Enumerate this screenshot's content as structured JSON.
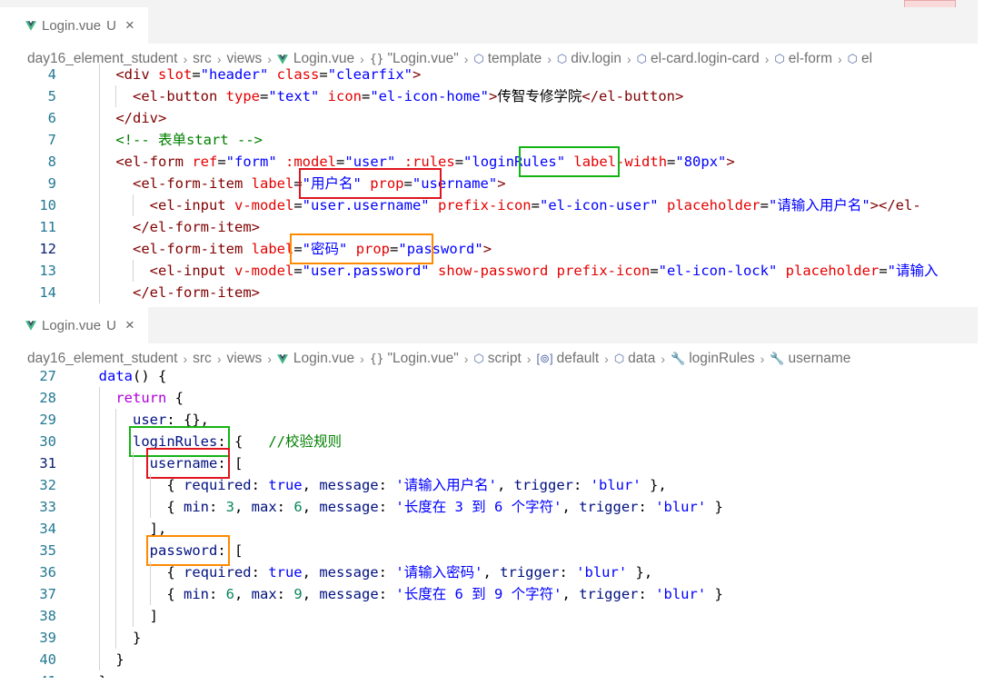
{
  "editor1": {
    "tab": {
      "file": "Login.vue",
      "status": "U",
      "close": "×"
    },
    "breadcrumb": [
      "day16_element_student",
      "src",
      "views",
      "Login.vue",
      "\"Login.vue\"",
      "template",
      "div.login",
      "el-card.login-card",
      "el-form",
      "el"
    ],
    "lines": [
      {
        "n": "4",
        "segs": [
          [
            "",
            "    "
          ],
          [
            "tag",
            "<div "
          ],
          [
            "attr",
            "slot"
          ],
          [
            "",
            "="
          ],
          [
            "str",
            "\"header\""
          ],
          [
            "",
            " "
          ],
          [
            "attr",
            "class"
          ],
          [
            "",
            "="
          ],
          [
            "str",
            "\"clearfix\""
          ],
          [
            "tag",
            ">"
          ]
        ]
      },
      {
        "n": "5",
        "segs": [
          [
            "",
            "      "
          ],
          [
            "tag",
            "<el-button "
          ],
          [
            "attr",
            "type"
          ],
          [
            "",
            "="
          ],
          [
            "str",
            "\"text\""
          ],
          [
            "",
            " "
          ],
          [
            "attr",
            "icon"
          ],
          [
            "",
            "="
          ],
          [
            "str",
            "\"el-icon-home\""
          ],
          [
            "tag",
            ">"
          ],
          [
            "",
            "传智专修学院"
          ],
          [
            "tag",
            "</el-button>"
          ]
        ]
      },
      {
        "n": "6",
        "segs": [
          [
            "",
            "    "
          ],
          [
            "tag",
            "</div>"
          ]
        ]
      },
      {
        "n": "7",
        "segs": [
          [
            "",
            "    "
          ],
          [
            "cmt",
            "<!-- 表单start -->"
          ]
        ]
      },
      {
        "n": "8",
        "segs": [
          [
            "",
            "    "
          ],
          [
            "tag",
            "<el-form "
          ],
          [
            "attr",
            "ref"
          ],
          [
            "",
            "="
          ],
          [
            "str",
            "\"form\""
          ],
          [
            "",
            " "
          ],
          [
            "attr",
            ":model"
          ],
          [
            "",
            "="
          ],
          [
            "str",
            "\"user\""
          ],
          [
            "",
            " "
          ],
          [
            "attr",
            ":rules"
          ],
          [
            "",
            "="
          ],
          [
            "str",
            "\"loginRules\""
          ],
          [
            "",
            " "
          ],
          [
            "attr",
            "label-width"
          ],
          [
            "",
            "="
          ],
          [
            "str",
            "\"80px\""
          ],
          [
            "tag",
            ">"
          ]
        ]
      },
      {
        "n": "9",
        "segs": [
          [
            "",
            "      "
          ],
          [
            "tag",
            "<el-form-item "
          ],
          [
            "attr",
            "label"
          ],
          [
            "",
            "="
          ],
          [
            "str",
            "\"用户名\""
          ],
          [
            "",
            " "
          ],
          [
            "attr",
            "prop"
          ],
          [
            "",
            "="
          ],
          [
            "str",
            "\"username\""
          ],
          [
            "tag",
            ">"
          ]
        ]
      },
      {
        "n": "10",
        "segs": [
          [
            "",
            "        "
          ],
          [
            "tag",
            "<el-input "
          ],
          [
            "attr",
            "v-model"
          ],
          [
            "",
            "="
          ],
          [
            "str",
            "\"user.username\""
          ],
          [
            "",
            " "
          ],
          [
            "attr",
            "prefix-icon"
          ],
          [
            "",
            "="
          ],
          [
            "str",
            "\"el-icon-user\""
          ],
          [
            "",
            " "
          ],
          [
            "attr",
            "placeholder"
          ],
          [
            "",
            "="
          ],
          [
            "str",
            "\"请输入用户名\""
          ],
          [
            "tag",
            "></el-"
          ]
        ]
      },
      {
        "n": "11",
        "segs": [
          [
            "",
            "      "
          ],
          [
            "tag",
            "</el-form-item>"
          ]
        ]
      },
      {
        "n": "12",
        "segs": [
          [
            "",
            "      "
          ],
          [
            "tag",
            "<el-form-item "
          ],
          [
            "attr",
            "label"
          ],
          [
            "",
            "="
          ],
          [
            "str",
            "\"密码\""
          ],
          [
            "",
            " "
          ],
          [
            "attr",
            "prop"
          ],
          [
            "",
            "="
          ],
          [
            "str",
            "\"password\""
          ],
          [
            "tag",
            ">"
          ]
        ]
      },
      {
        "n": "13",
        "segs": [
          [
            "",
            "        "
          ],
          [
            "tag",
            "<el-input "
          ],
          [
            "attr",
            "v-model"
          ],
          [
            "",
            "="
          ],
          [
            "str",
            "\"user.password\""
          ],
          [
            "",
            " "
          ],
          [
            "attr",
            "show-password"
          ],
          [
            "",
            " "
          ],
          [
            "attr",
            "prefix-icon"
          ],
          [
            "",
            "="
          ],
          [
            "str",
            "\"el-icon-lock\""
          ],
          [
            "",
            " "
          ],
          [
            "attr",
            "placeholder"
          ],
          [
            "",
            "="
          ],
          [
            "str",
            "\"请输入"
          ]
        ]
      },
      {
        "n": "14",
        "segs": [
          [
            "",
            "      "
          ],
          [
            "tag",
            "</el-form-item>"
          ]
        ]
      }
    ]
  },
  "editor2": {
    "tab": {
      "file": "Login.vue",
      "status": "U",
      "close": "×"
    },
    "breadcrumb": [
      "day16_element_student",
      "src",
      "views",
      "Login.vue",
      "\"Login.vue\"",
      "script",
      "default",
      "data",
      "loginRules",
      "username"
    ],
    "lines": [
      {
        "n": "27",
        "segs": [
          [
            "",
            "  "
          ],
          [
            "kw",
            "data"
          ],
          [
            "",
            "() {"
          ]
        ]
      },
      {
        "n": "28",
        "segs": [
          [
            "",
            "    "
          ],
          [
            "ctl",
            "return"
          ],
          [
            "",
            " {"
          ]
        ]
      },
      {
        "n": "29",
        "segs": [
          [
            "",
            "      "
          ],
          [
            "prop",
            "user"
          ],
          [
            "",
            ": {},"
          ]
        ]
      },
      {
        "n": "30",
        "segs": [
          [
            "",
            "      "
          ],
          [
            "prop",
            "loginRules"
          ],
          [
            "",
            ": {   "
          ],
          [
            "cmt",
            "//校验规则"
          ]
        ]
      },
      {
        "n": "31",
        "segs": [
          [
            "",
            "        "
          ],
          [
            "prop",
            "username"
          ],
          [
            "",
            ": ["
          ]
        ]
      },
      {
        "n": "32",
        "segs": [
          [
            "",
            "          { "
          ],
          [
            "prop",
            "required"
          ],
          [
            "",
            ": "
          ],
          [
            "kw",
            "true"
          ],
          [
            "",
            ", "
          ],
          [
            "prop",
            "message"
          ],
          [
            "",
            ": "
          ],
          [
            "str",
            "'请输入用户名'"
          ],
          [
            "",
            ", "
          ],
          [
            "prop",
            "trigger"
          ],
          [
            "",
            ": "
          ],
          [
            "str",
            "'blur'"
          ],
          [
            "",
            " },"
          ]
        ]
      },
      {
        "n": "33",
        "segs": [
          [
            "",
            "          { "
          ],
          [
            "prop",
            "min"
          ],
          [
            "",
            ": "
          ],
          [
            "num",
            "3"
          ],
          [
            "",
            ", "
          ],
          [
            "prop",
            "max"
          ],
          [
            "",
            ": "
          ],
          [
            "num",
            "6"
          ],
          [
            "",
            ", "
          ],
          [
            "prop",
            "message"
          ],
          [
            "",
            ": "
          ],
          [
            "str",
            "'长度在 3 到 6 个字符'"
          ],
          [
            "",
            ", "
          ],
          [
            "prop",
            "trigger"
          ],
          [
            "",
            ": "
          ],
          [
            "str",
            "'blur'"
          ],
          [
            "",
            " }"
          ]
        ]
      },
      {
        "n": "34",
        "segs": [
          [
            "",
            "        ],"
          ]
        ]
      },
      {
        "n": "35",
        "segs": [
          [
            "",
            "        "
          ],
          [
            "prop",
            "password"
          ],
          [
            "",
            ": ["
          ]
        ]
      },
      {
        "n": "36",
        "segs": [
          [
            "",
            "          { "
          ],
          [
            "prop",
            "required"
          ],
          [
            "",
            ": "
          ],
          [
            "kw",
            "true"
          ],
          [
            "",
            ", "
          ],
          [
            "prop",
            "message"
          ],
          [
            "",
            ": "
          ],
          [
            "str",
            "'请输入密码'"
          ],
          [
            "",
            ", "
          ],
          [
            "prop",
            "trigger"
          ],
          [
            "",
            ": "
          ],
          [
            "str",
            "'blur'"
          ],
          [
            "",
            " },"
          ]
        ]
      },
      {
        "n": "37",
        "segs": [
          [
            "",
            "          { "
          ],
          [
            "prop",
            "min"
          ],
          [
            "",
            ": "
          ],
          [
            "num",
            "6"
          ],
          [
            "",
            ", "
          ],
          [
            "prop",
            "max"
          ],
          [
            "",
            ": "
          ],
          [
            "num",
            "9"
          ],
          [
            "",
            ", "
          ],
          [
            "prop",
            "message"
          ],
          [
            "",
            ": "
          ],
          [
            "str",
            "'长度在 6 到 9 个字符'"
          ],
          [
            "",
            ", "
          ],
          [
            "prop",
            "trigger"
          ],
          [
            "",
            ": "
          ],
          [
            "str",
            "'blur'"
          ],
          [
            "",
            " }"
          ]
        ]
      },
      {
        "n": "38",
        "segs": [
          [
            "",
            "        ]"
          ]
        ]
      },
      {
        "n": "39",
        "segs": [
          [
            "",
            "      }"
          ]
        ]
      },
      {
        "n": "40",
        "segs": [
          [
            "",
            "    }"
          ]
        ]
      },
      {
        "n": "41",
        "segs": [
          [
            "",
            "  },"
          ]
        ]
      }
    ]
  },
  "colors": {
    "highlight_green": "#14b314",
    "highlight_red": "#e0151f",
    "highlight_orange": "#ff8a00"
  }
}
